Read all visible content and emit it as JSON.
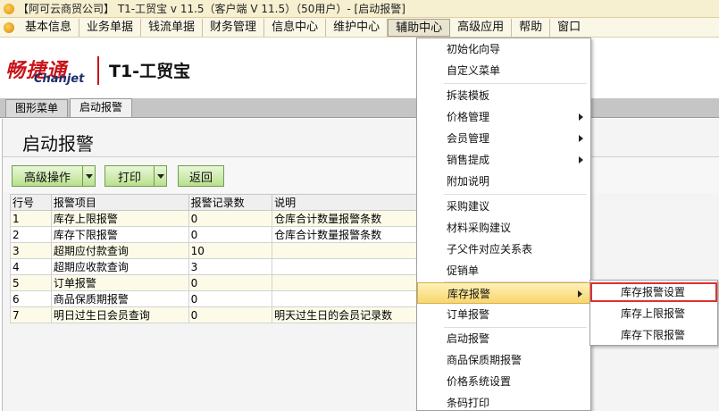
{
  "window": {
    "title": "【阿可云商贸公司】 T1-工贸宝 v 11.5（客户端 V 11.5）（50用户）- [启动报警]"
  },
  "menubar": {
    "items": [
      "基本信息",
      "业务单据",
      "钱流单据",
      "财务管理",
      "信息中心",
      "维护中心",
      "辅助中心",
      "高级应用",
      "帮助",
      "窗口"
    ],
    "active": "辅助中心"
  },
  "brand": {
    "logo_cn": "畅捷通",
    "logo_en": "Chanjet",
    "product": "T1-工贸宝"
  },
  "tabs": [
    "图形菜单",
    "启动报警"
  ],
  "page": {
    "title": "启动报警"
  },
  "toolbar": {
    "advanced_label": "高级操作",
    "print_label": "打印",
    "back_label": "返回"
  },
  "table": {
    "headers": [
      "行号",
      "报警项目",
      "报警记录数",
      "说明"
    ],
    "rows": [
      [
        "1",
        "库存上限报警",
        "0",
        "仓库合计数量报警条数"
      ],
      [
        "2",
        "库存下限报警",
        "0",
        "仓库合计数量报警条数"
      ],
      [
        "3",
        "超期应付款查询",
        "10",
        ""
      ],
      [
        "4",
        "超期应收款查询",
        "3",
        ""
      ],
      [
        "5",
        "订单报警",
        "0",
        ""
      ],
      [
        "6",
        "商品保质期报警",
        "0",
        ""
      ],
      [
        "7",
        "明日过生日会员查询",
        "0",
        "明天过生日的会员记录数"
      ]
    ]
  },
  "dropdown": {
    "items": [
      {
        "label": "初始化向导"
      },
      {
        "label": "自定义菜单"
      },
      {
        "label": "拆装模板"
      },
      {
        "label": "价格管理"
      },
      {
        "label": "会员管理"
      },
      {
        "label": "销售提成"
      },
      {
        "label": "附加说明"
      },
      {
        "label": "采购建议"
      },
      {
        "label": "材料采购建议"
      },
      {
        "label": "子父件对应关系表"
      },
      {
        "label": "促销单"
      },
      {
        "label": "库存报警"
      },
      {
        "label": "订单报警"
      },
      {
        "label": "启动报警"
      },
      {
        "label": "商品保质期报警"
      },
      {
        "label": "价格系统设置"
      },
      {
        "label": "条码打印"
      }
    ]
  },
  "submenu": {
    "items": [
      "库存报警设置",
      "库存上限报警",
      "库存下限报警"
    ]
  },
  "colors": {
    "accent_red": "#e03030",
    "menu_highlight": "#f8d66d",
    "button_green": "#b9e08e",
    "brand_red": "#c8141a"
  }
}
